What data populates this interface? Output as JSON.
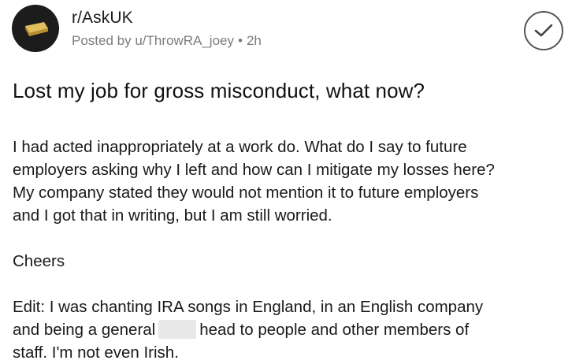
{
  "post": {
    "subreddit": "r/AskUK",
    "posted_by": "Posted by u/ThrowRA_joey",
    "separator": "•",
    "age": "2h",
    "avatar_icon": "gold-bar-icon",
    "joined_icon": "checkmark-circle-icon",
    "title": "Lost my job for gross misconduct, what now?",
    "body": {
      "paragraph1_lines": [
        "I had acted inappropriately at a work do. What do I say to future",
        "employers asking why I left and how can I mitigate my losses here?",
        "My company stated they would not mention it to future employers",
        "and I got that in writing, but I am still worried."
      ],
      "paragraph2": "Cheers",
      "edit_line1": "Edit: I was chanting IRA songs in England, in an English company",
      "edit_line2_before": "and being a general",
      "edit_line2_after": "head to people and other members of",
      "edit_line3": "staff. I'm not even Irish."
    }
  },
  "colors": {
    "text": "#1a1a1b",
    "meta": "#7c7c7c",
    "avatar_bg": "#1c1c1c",
    "gold": "#c9a23a"
  }
}
